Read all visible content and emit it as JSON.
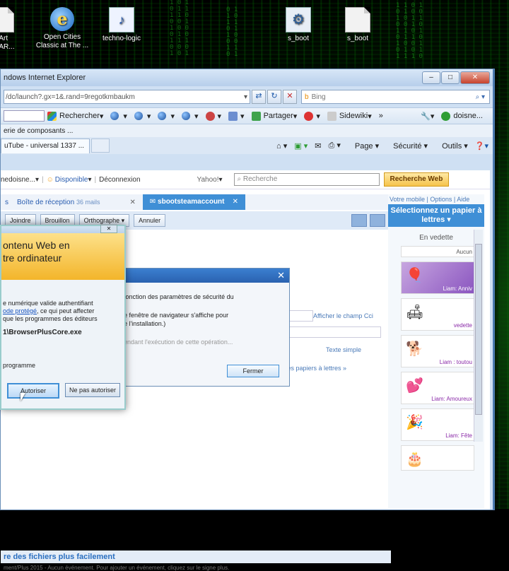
{
  "desktop": {
    "icons": [
      {
        "label": "nArt\nHe AR...",
        "icon": "document-icon"
      },
      {
        "label": "Open Cities\nClassic at The ...",
        "icon": "ie-icon"
      },
      {
        "label": "techno-logic",
        "icon": "wav-file-icon"
      },
      {
        "label": "s_boot",
        "icon": "config-icon"
      },
      {
        "label": "s_boot",
        "icon": "document-icon"
      }
    ]
  },
  "ie": {
    "title": "ndows Internet Explorer",
    "address": "/dc/launch?.gx=1&.rand=9regotkmbaukm",
    "search_placeholder": "Bing",
    "toolbar": {
      "rechercher": "Rechercher",
      "partager": "Partager",
      "sidewiki": "Sidewiki",
      "user": "doisne..."
    },
    "fav_bar": "erie de composants ...",
    "tab_title": "uTube - universal 1337 ...",
    "commands": {
      "page": "Page",
      "securite": "Sécurité",
      "outils": "Outils"
    }
  },
  "yahoo": {
    "user": "nedoisne...",
    "status": "Disponible",
    "deconnexion": "Déconnexion",
    "brand": "Yahoo!",
    "search_placeholder": "Recherche",
    "search_button": "Recherche Web"
  },
  "mail": {
    "tab_left": "s",
    "inbox": "Boîte de réception",
    "inbox_count": "36 mails",
    "active_tab": "sbootsteamaccount",
    "compose_buttons": [
      "Joindre",
      "Brouillon",
      "Orthographe",
      "Annuler"
    ],
    "cc_link": "Afficher le champ Cci",
    "plain_text": "Texte simple",
    "papers_link": "r les papiers à lettres",
    "footer_link": "re des fichiers plus facilement",
    "footer_text": "ment/Plus 2015 - Aucun événement. Pour ajouter un événement, cliquez sur le signe plus."
  },
  "right_panel": {
    "links": "Votre mobile | Options | Aide",
    "heading": "Sélectionnez un papier à lettres",
    "featured": "En vedette",
    "cards": [
      {
        "label": "Aucun"
      },
      {
        "label": "Liam: Anniv"
      },
      {
        "label": "vedette"
      },
      {
        "label": "Liam : toutou"
      },
      {
        "label": "Liam: Amoureux"
      },
      {
        "label": "Liam: Fête"
      },
      {
        "label": ""
      }
    ]
  },
  "security_dialog": {
    "banner": "ontenu Web en\ntre ordinateur",
    "body1": "e numérique valide authentifiant",
    "body_link": "ode protégé",
    "body2": ", ce qui peut affecter",
    "body3": "que les programmes des éditeurs",
    "file": "1\\BrowserPlusCore.exe",
    "program": "programme",
    "allow": "Autoriser",
    "deny": "Ne pas autoriser"
  },
  "download_dialog": {
    "line1": "fonction des paramètres de sécurité du",
    "line2": "e fenêtre de navigateur s'affiche pour",
    "line3": "e l'installation.)",
    "waiting": "endant l'exécution de cette opération...",
    "close": "Fermer"
  }
}
